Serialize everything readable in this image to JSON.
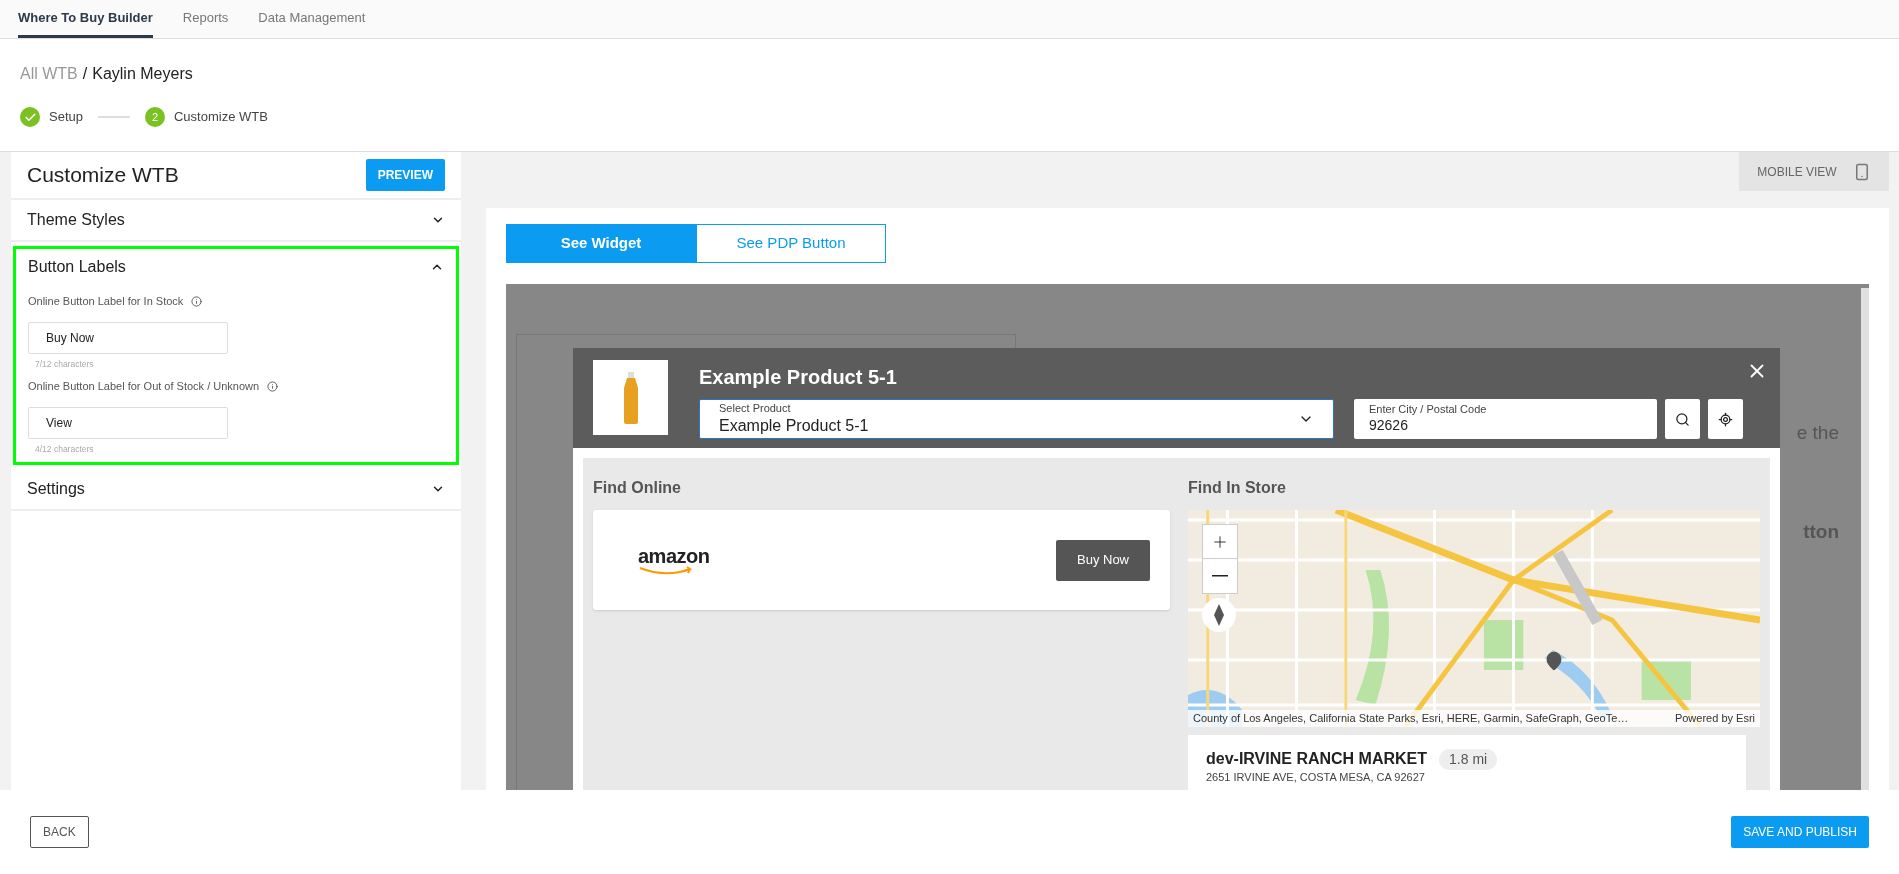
{
  "nav_tabs": [
    {
      "label": "Where To Buy Builder",
      "selected": true
    },
    {
      "label": "Reports",
      "selected": false
    },
    {
      "label": "Data Management",
      "selected": false
    }
  ],
  "breadcrumb": {
    "parent": "All WTB",
    "separator": "/",
    "current": "Kaylin Meyers"
  },
  "steps": [
    {
      "label": "Setup",
      "completed": true
    },
    {
      "label": "Customize WTB",
      "completed": false,
      "number": "2"
    }
  ],
  "sidebar": {
    "title": "Customize WTB",
    "preview_button": "PREVIEW",
    "sections": [
      {
        "title": "Theme Styles",
        "expanded": false,
        "highlighted": false
      },
      {
        "title": "Button Labels",
        "expanded": true,
        "highlighted": true,
        "fields": [
          {
            "label": "Online Button Label for In Stock",
            "value": "Buy Now",
            "counter": "7/12 characters"
          },
          {
            "label": "Online Button Label for Out of Stock / Unknown",
            "value": "View",
            "counter": "4/12 characters"
          }
        ]
      },
      {
        "title": "Settings",
        "expanded": false,
        "highlighted": false
      }
    ]
  },
  "mobile_view_button": "MOBILE VIEW",
  "view_tabs": [
    {
      "label": "See Widget",
      "selected": true
    },
    {
      "label": "See PDP Button",
      "selected": false
    }
  ],
  "preview": {
    "background_text": [
      "e the",
      "tton"
    ],
    "widget": {
      "title": "Example Product 5-1",
      "select": {
        "label": "Select Product",
        "value": "Example Product 5-1"
      },
      "location": {
        "label": "Enter City / Postal Code",
        "value": "92626"
      },
      "find_online": {
        "title": "Find Online",
        "retailers": [
          {
            "name": "amazon",
            "button": "Buy Now"
          }
        ]
      },
      "find_in_store": {
        "title": "Find In Store",
        "map_attribution": "County of Los Angeles, California State Parks, Esri, HERE, Garmin, SafeGraph, GeoTe…",
        "map_powered_by": "Powered by Esri",
        "stores": [
          {
            "name": "dev-IRVINE RANCH MARKET",
            "distance": "1.8 mi",
            "address": "2651 IRVINE AVE, COSTA MESA, CA 92627"
          }
        ]
      }
    }
  },
  "footer": {
    "back": "BACK",
    "publish": "SAVE AND PUBLISH"
  }
}
